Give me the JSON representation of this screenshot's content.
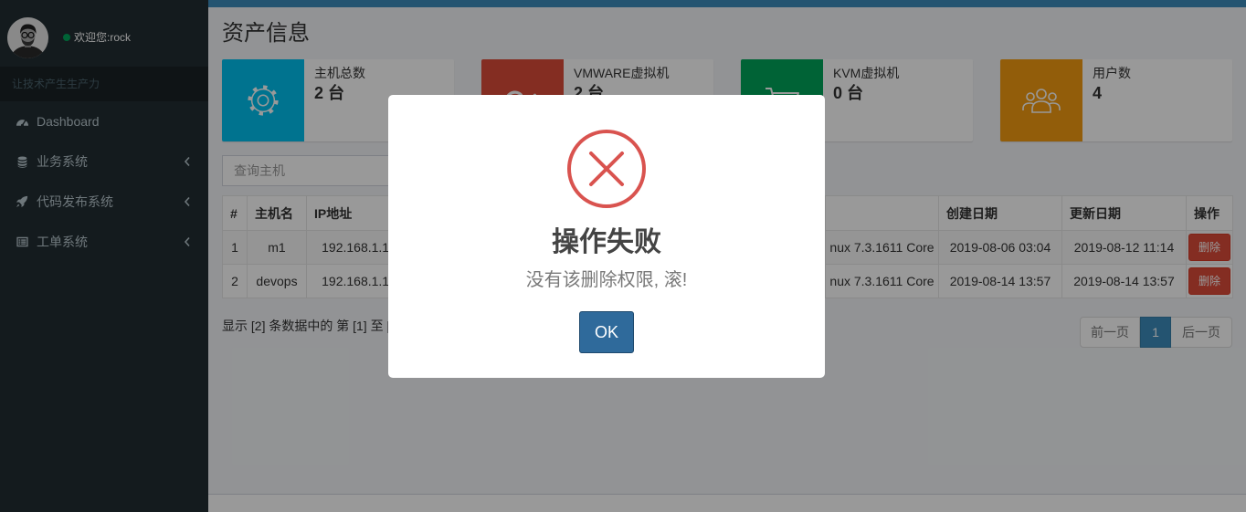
{
  "sidebar": {
    "user": {
      "greeting": "欢迎您:rock",
      "status_color": "#00a65a"
    },
    "slogan": "让技术产生生产力",
    "menu": [
      {
        "label": "Dashboard",
        "icon": "dashboard-icon",
        "has_submenu": false
      },
      {
        "label": "业务系统",
        "icon": "database-icon",
        "has_submenu": true
      },
      {
        "label": "代码发布系统",
        "icon": "rocket-icon",
        "has_submenu": true
      },
      {
        "label": "工单系统",
        "icon": "list-icon",
        "has_submenu": true
      }
    ]
  },
  "page": {
    "title": "资产信息"
  },
  "info_boxes": [
    {
      "label": "主机总数",
      "value": "2 台",
      "color": "#00c0ef",
      "icon": "gear-icon"
    },
    {
      "label": "VMWARE虚拟机",
      "value": "2 台",
      "color": "#dd4b39",
      "icon": "google-plus-icon"
    },
    {
      "label": "KVM虚拟机",
      "value": "0 台",
      "color": "#00a65a",
      "icon": "cart-icon"
    },
    {
      "label": "用户数",
      "value": "4",
      "color": "#f39c12",
      "icon": "users-icon"
    }
  ],
  "search": {
    "placeholder": "查询主机"
  },
  "table": {
    "headers": {
      "index": "#",
      "hostname": "主机名",
      "ip": "IP地址",
      "created": "创建日期",
      "updated": "更新日期",
      "action": "操作"
    },
    "rows": [
      {
        "index": "1",
        "hostname": "m1",
        "ip": "192.168.1.10",
        "os": "nux 7.3.1611 Core",
        "created": "2019-08-06 03:04",
        "updated": "2019-08-12 11:14",
        "action": "删除"
      },
      {
        "index": "2",
        "hostname": "devops",
        "ip": "192.168.1.10",
        "os": "nux 7.3.1611 Core",
        "created": "2019-08-14 13:57",
        "updated": "2019-08-14 13:57",
        "action": "删除"
      }
    ]
  },
  "pagination": {
    "info": "显示 [2] 条数据中的 第 [1] 至 [",
    "prev": "前一页",
    "current": "1",
    "next": "后一页"
  },
  "modal": {
    "icon": "error-icon",
    "icon_color": "#d9534f",
    "title": "操作失败",
    "text": "没有该删除权限, 滚!",
    "confirm": "OK",
    "confirm_color": "#2f6a9b"
  }
}
